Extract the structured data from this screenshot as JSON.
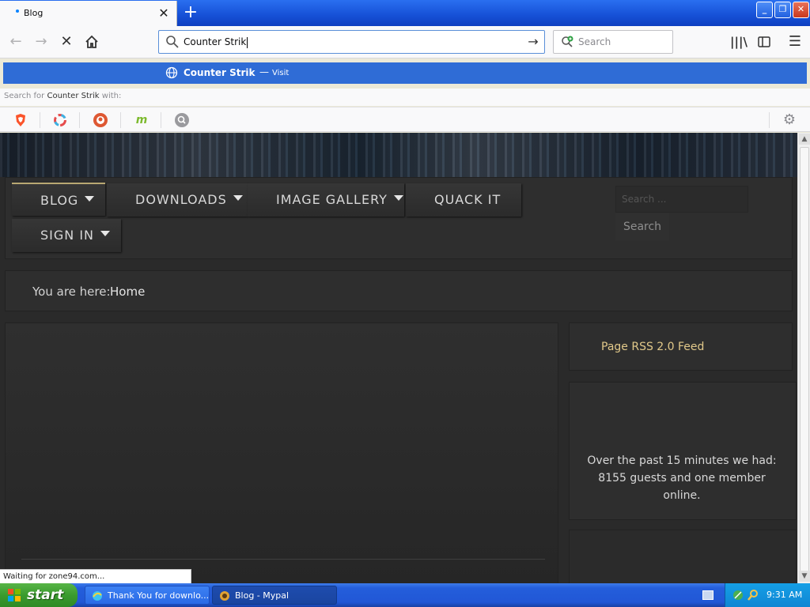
{
  "browser": {
    "tab_title": "Blog",
    "url_input_value": "Counter Strik",
    "search_placeholder": "Search",
    "suggestion": {
      "text": "Counter Strik",
      "dash": "—",
      "visit": "Visit"
    },
    "search_for": {
      "prefix": "Search for",
      "query": "Counter Strik",
      "suffix": "with:"
    },
    "accent_color": "#2f6cd6"
  },
  "site": {
    "menu": [
      {
        "label": "BLOG",
        "has_caret": true,
        "active": true
      },
      {
        "label": "DOWNLOADS",
        "has_caret": true
      },
      {
        "label": "IMAGE GALLERY",
        "has_caret": true
      },
      {
        "label": "QUACK IT",
        "has_caret": false
      },
      {
        "label": "SIGN IN",
        "has_caret": true
      }
    ],
    "search_placeholder": "Search ...",
    "search_button": "Search",
    "breadcrumb": {
      "label": "You are here:",
      "current": "Home"
    },
    "rss_link": "Page RSS 2.0 Feed",
    "online_stats": "Over the past 15 minutes we had: 8155 guests and one member online.",
    "link_color": "#e2c98a"
  },
  "status_bar": "Waiting for zone94.com...",
  "taskbar": {
    "start": "start",
    "tasks": [
      {
        "label": "Thank You for downlo...",
        "active": false
      },
      {
        "label": "Blog - Mypal",
        "active": true
      }
    ],
    "clock": "9:31 AM"
  }
}
